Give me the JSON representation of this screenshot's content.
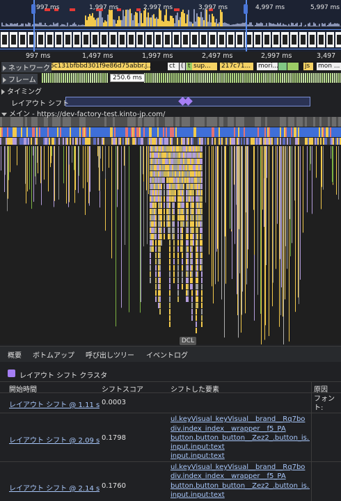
{
  "overview": {
    "ticks": [
      "997 ms",
      "1,997 ms",
      "2,997 ms",
      "3,997 ms",
      "4,997 ms",
      "5,997 ms"
    ]
  },
  "ruler": {
    "ticks": [
      "997 ms",
      "1,497 ms",
      "1,997 ms",
      "2,497 ms",
      "2,997 ms",
      "3,497"
    ]
  },
  "tracks": {
    "network_label": "ネットワーク",
    "network_requests": [
      "5c131bfbbd301f9e86d75abbr.j...",
      "ct",
      "(",
      ",",
      "t",
      "sup...",
      "217c71...",
      "mori...",
      "js",
      "mon ..."
    ],
    "frames_label": "フレーム",
    "frame_time": "250.6 ms",
    "timings_label": "タイミング",
    "layout_shift_label": "レイアウト シフト",
    "main_label": "メイン - https://dev-factory-test.kinto-jp.com/",
    "dcl": "DCL"
  },
  "tabs": [
    "概要",
    "ボトムアップ",
    "呼び出しツリー",
    "イベントログ"
  ],
  "summary": {
    "title": "レイアウト シフト クラスタ",
    "columns": [
      "開始時間",
      "シフトスコア",
      "シフトした要素",
      "原因"
    ],
    "rows": [
      {
        "start": "レイアウト シフト @ 1.11 s",
        "score": "0.0003",
        "elements": [],
        "cause": "フォント:"
      },
      {
        "start": "レイアウト シフト @ 2.09 s",
        "score": "0.1798",
        "elements": [
          "ul.keyVisual_keyVisual__brand__Rq7bo",
          "div.index_index__wrapper__f5_PA",
          "button.button_button__Zez2_.button_is...",
          "input.input:text",
          "input.input:text"
        ],
        "cause": ""
      },
      {
        "start": "レイアウト シフト @ 2.14 s",
        "score": "0.1760",
        "elements": [
          "ul.keyVisual_keyVisual__brand__Rq7bo",
          "div.index_index__wrapper__f5_PA",
          "button.button_button__Zez2_.button_is...",
          "input.input:text"
        ],
        "cause": ""
      }
    ]
  },
  "colors": {
    "scripting": "#f2c94c",
    "rendering": "#b39ddb",
    "painting": "#7cb342",
    "network_blue": "#3f6fd8",
    "selection": "#5b8def",
    "layout_shift": "#a57ef5"
  }
}
